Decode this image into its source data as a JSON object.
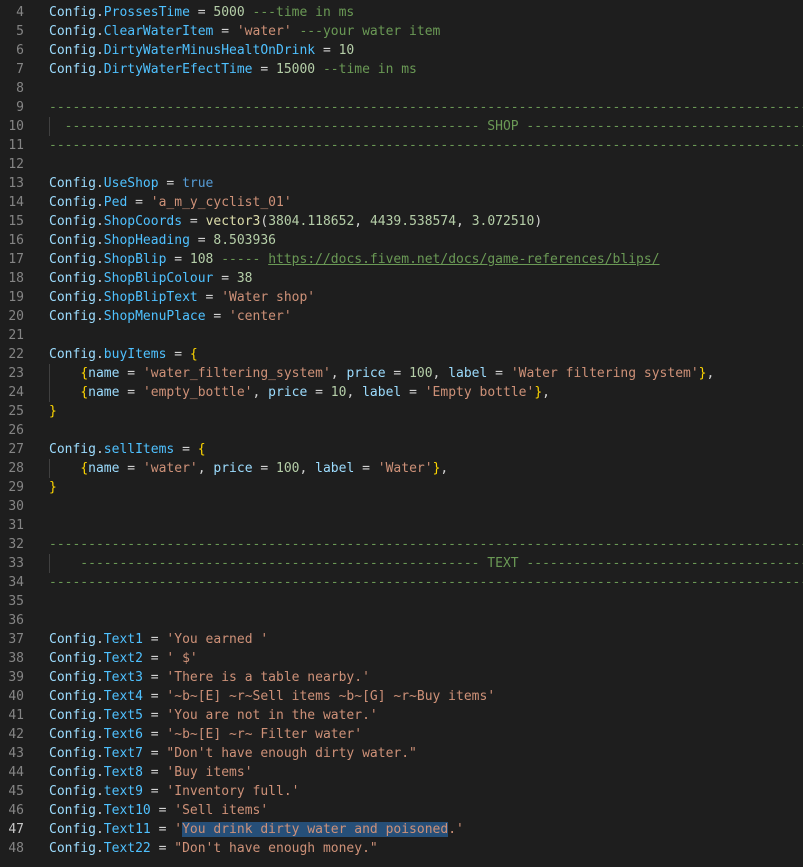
{
  "editor": {
    "active_line": 47,
    "lines": [
      {
        "n": 4,
        "tokens": [
          [
            "t-table",
            "Config"
          ],
          [
            "t-op",
            "."
          ],
          [
            "t-prop",
            "ProssesTime"
          ],
          [
            "t-op",
            " = "
          ],
          [
            "t-num",
            "5000"
          ],
          [
            "t-op",
            " "
          ],
          [
            "t-com",
            "---time in ms"
          ]
        ]
      },
      {
        "n": 5,
        "tokens": [
          [
            "t-table",
            "Config"
          ],
          [
            "t-op",
            "."
          ],
          [
            "t-prop",
            "ClearWaterItem"
          ],
          [
            "t-op",
            " = "
          ],
          [
            "t-str",
            "'water'"
          ],
          [
            "t-op",
            " "
          ],
          [
            "t-com",
            "---your water item"
          ]
        ]
      },
      {
        "n": 6,
        "tokens": [
          [
            "t-table",
            "Config"
          ],
          [
            "t-op",
            "."
          ],
          [
            "t-prop",
            "DirtyWaterMinusHealtOnDrink"
          ],
          [
            "t-op",
            " = "
          ],
          [
            "t-num",
            "10"
          ]
        ]
      },
      {
        "n": 7,
        "tokens": [
          [
            "t-table",
            "Config"
          ],
          [
            "t-op",
            "."
          ],
          [
            "t-prop",
            "DirtyWaterEfectTime"
          ],
          [
            "t-op",
            " = "
          ],
          [
            "t-num",
            "15000"
          ],
          [
            "t-op",
            " "
          ],
          [
            "t-com",
            "--time in ms"
          ]
        ]
      },
      {
        "n": 8,
        "tokens": []
      },
      {
        "n": 9,
        "tokens": [
          [
            "t-com",
            "--------------------------------------------------------------------------------------------------------------------------------"
          ]
        ]
      },
      {
        "n": 10,
        "tokens": [
          [
            "t-com",
            "  ----------------------------------------------------- SHOP ---------------------------------------------------------------------"
          ]
        ]
      },
      {
        "n": 11,
        "tokens": [
          [
            "t-com",
            "--------------------------------------------------------------------------------------------------------------------------------"
          ]
        ]
      },
      {
        "n": 12,
        "tokens": []
      },
      {
        "n": 13,
        "tokens": [
          [
            "t-table",
            "Config"
          ],
          [
            "t-op",
            "."
          ],
          [
            "t-prop",
            "UseShop"
          ],
          [
            "t-op",
            " = "
          ],
          [
            "t-kw",
            "true"
          ]
        ]
      },
      {
        "n": 14,
        "tokens": [
          [
            "t-table",
            "Config"
          ],
          [
            "t-op",
            "."
          ],
          [
            "t-prop",
            "Ped"
          ],
          [
            "t-op",
            " = "
          ],
          [
            "t-str",
            "'a_m_y_cyclist_01'"
          ]
        ]
      },
      {
        "n": 15,
        "tokens": [
          [
            "t-table",
            "Config"
          ],
          [
            "t-op",
            "."
          ],
          [
            "t-prop",
            "ShopCoords"
          ],
          [
            "t-op",
            " = "
          ],
          [
            "t-fn",
            "vector3"
          ],
          [
            "t-op",
            "("
          ],
          [
            "t-num",
            "3804.118652"
          ],
          [
            "t-op",
            ", "
          ],
          [
            "t-num",
            "4439.538574"
          ],
          [
            "t-op",
            ", "
          ],
          [
            "t-num",
            "3.072510"
          ],
          [
            "t-op",
            ")"
          ]
        ]
      },
      {
        "n": 16,
        "tokens": [
          [
            "t-table",
            "Config"
          ],
          [
            "t-op",
            "."
          ],
          [
            "t-prop",
            "ShopHeading"
          ],
          [
            "t-op",
            " = "
          ],
          [
            "t-num",
            "8.503936"
          ]
        ]
      },
      {
        "n": 17,
        "tokens": [
          [
            "t-table",
            "Config"
          ],
          [
            "t-op",
            "."
          ],
          [
            "t-prop",
            "ShopBlip"
          ],
          [
            "t-op",
            " = "
          ],
          [
            "t-num",
            "108"
          ],
          [
            "t-op",
            " "
          ],
          [
            "t-com",
            "----- "
          ],
          [
            "t-link",
            "https://docs.fivem.net/docs/game-references/blips/"
          ]
        ]
      },
      {
        "n": 18,
        "tokens": [
          [
            "t-table",
            "Config"
          ],
          [
            "t-op",
            "."
          ],
          [
            "t-prop",
            "ShopBlipColour"
          ],
          [
            "t-op",
            " = "
          ],
          [
            "t-num",
            "38"
          ]
        ]
      },
      {
        "n": 19,
        "tokens": [
          [
            "t-table",
            "Config"
          ],
          [
            "t-op",
            "."
          ],
          [
            "t-prop",
            "ShopBlipText"
          ],
          [
            "t-op",
            " = "
          ],
          [
            "t-str",
            "'Water shop'"
          ]
        ]
      },
      {
        "n": 20,
        "tokens": [
          [
            "t-table",
            "Config"
          ],
          [
            "t-op",
            "."
          ],
          [
            "t-prop",
            "ShopMenuPlace"
          ],
          [
            "t-op",
            " = "
          ],
          [
            "t-str",
            "'center'"
          ]
        ]
      },
      {
        "n": 21,
        "tokens": []
      },
      {
        "n": 22,
        "tokens": [
          [
            "t-table",
            "Config"
          ],
          [
            "t-op",
            "."
          ],
          [
            "t-prop",
            "buyItems"
          ],
          [
            "t-op",
            " = "
          ],
          [
            "t-brace",
            "{"
          ]
        ]
      },
      {
        "n": 23,
        "tokens": [
          [
            "t-op",
            "    "
          ],
          [
            "t-brace",
            "{"
          ],
          [
            "t-key",
            "name"
          ],
          [
            "t-op",
            " = "
          ],
          [
            "t-str",
            "'water_filtering_system'"
          ],
          [
            "t-op",
            ", "
          ],
          [
            "t-key",
            "price"
          ],
          [
            "t-op",
            " = "
          ],
          [
            "t-num",
            "100"
          ],
          [
            "t-op",
            ", "
          ],
          [
            "t-key",
            "label"
          ],
          [
            "t-op",
            " = "
          ],
          [
            "t-str",
            "'Water filtering system'"
          ],
          [
            "t-brace",
            "}"
          ],
          [
            "t-op",
            ","
          ]
        ]
      },
      {
        "n": 24,
        "tokens": [
          [
            "t-op",
            "    "
          ],
          [
            "t-brace",
            "{"
          ],
          [
            "t-key",
            "name"
          ],
          [
            "t-op",
            " = "
          ],
          [
            "t-str",
            "'empty_bottle'"
          ],
          [
            "t-op",
            ", "
          ],
          [
            "t-key",
            "price"
          ],
          [
            "t-op",
            " = "
          ],
          [
            "t-num",
            "10"
          ],
          [
            "t-op",
            ", "
          ],
          [
            "t-key",
            "label"
          ],
          [
            "t-op",
            " = "
          ],
          [
            "t-str",
            "'Empty bottle'"
          ],
          [
            "t-brace",
            "}"
          ],
          [
            "t-op",
            ","
          ]
        ]
      },
      {
        "n": 25,
        "tokens": [
          [
            "t-brace",
            "}"
          ]
        ]
      },
      {
        "n": 26,
        "tokens": []
      },
      {
        "n": 27,
        "tokens": [
          [
            "t-table",
            "Config"
          ],
          [
            "t-op",
            "."
          ],
          [
            "t-prop",
            "sellItems"
          ],
          [
            "t-op",
            " = "
          ],
          [
            "t-brace",
            "{"
          ]
        ]
      },
      {
        "n": 28,
        "tokens": [
          [
            "t-op",
            "    "
          ],
          [
            "t-brace",
            "{"
          ],
          [
            "t-key",
            "name"
          ],
          [
            "t-op",
            " = "
          ],
          [
            "t-str",
            "'water'"
          ],
          [
            "t-op",
            ", "
          ],
          [
            "t-key",
            "price"
          ],
          [
            "t-op",
            " = "
          ],
          [
            "t-num",
            "100"
          ],
          [
            "t-op",
            ", "
          ],
          [
            "t-key",
            "label"
          ],
          [
            "t-op",
            " = "
          ],
          [
            "t-str",
            "'Water'"
          ],
          [
            "t-brace",
            "}"
          ],
          [
            "t-op",
            ","
          ]
        ]
      },
      {
        "n": 29,
        "tokens": [
          [
            "t-brace",
            "}"
          ]
        ]
      },
      {
        "n": 30,
        "tokens": []
      },
      {
        "n": 31,
        "tokens": []
      },
      {
        "n": 32,
        "tokens": [
          [
            "t-com",
            "--------------------------------------------------------------------------------------------------------------------------------"
          ]
        ]
      },
      {
        "n": 33,
        "tokens": [
          [
            "t-com",
            "    --------------------------------------------------- TEXT -------------------------------------------------------------------"
          ]
        ]
      },
      {
        "n": 34,
        "tokens": [
          [
            "t-com",
            "--------------------------------------------------------------------------------------------------------------------------------"
          ]
        ]
      },
      {
        "n": 35,
        "tokens": []
      },
      {
        "n": 36,
        "tokens": []
      },
      {
        "n": 37,
        "tokens": [
          [
            "t-table",
            "Config"
          ],
          [
            "t-op",
            "."
          ],
          [
            "t-prop",
            "Text1"
          ],
          [
            "t-op",
            " = "
          ],
          [
            "t-str",
            "'You earned '"
          ]
        ]
      },
      {
        "n": 38,
        "tokens": [
          [
            "t-table",
            "Config"
          ],
          [
            "t-op",
            "."
          ],
          [
            "t-prop",
            "Text2"
          ],
          [
            "t-op",
            " = "
          ],
          [
            "t-str",
            "' $'"
          ]
        ]
      },
      {
        "n": 39,
        "tokens": [
          [
            "t-table",
            "Config"
          ],
          [
            "t-op",
            "."
          ],
          [
            "t-prop",
            "Text3"
          ],
          [
            "t-op",
            " = "
          ],
          [
            "t-str",
            "'There is a table nearby.'"
          ]
        ]
      },
      {
        "n": 40,
        "tokens": [
          [
            "t-table",
            "Config"
          ],
          [
            "t-op",
            "."
          ],
          [
            "t-prop",
            "Text4"
          ],
          [
            "t-op",
            " = "
          ],
          [
            "t-str",
            "'~b~[E] ~r~Sell items ~b~[G] ~r~Buy items'"
          ]
        ]
      },
      {
        "n": 41,
        "tokens": [
          [
            "t-table",
            "Config"
          ],
          [
            "t-op",
            "."
          ],
          [
            "t-prop",
            "Text5"
          ],
          [
            "t-op",
            " = "
          ],
          [
            "t-str",
            "'You are not in the water.'"
          ]
        ]
      },
      {
        "n": 42,
        "tokens": [
          [
            "t-table",
            "Config"
          ],
          [
            "t-op",
            "."
          ],
          [
            "t-prop",
            "Text6"
          ],
          [
            "t-op",
            " = "
          ],
          [
            "t-str",
            "'~b~[E] ~r~ Filter water'"
          ]
        ]
      },
      {
        "n": 43,
        "tokens": [
          [
            "t-table",
            "Config"
          ],
          [
            "t-op",
            "."
          ],
          [
            "t-prop",
            "Text7"
          ],
          [
            "t-op",
            " = "
          ],
          [
            "t-str",
            "\"Don't have enough dirty water.\""
          ]
        ]
      },
      {
        "n": 44,
        "tokens": [
          [
            "t-table",
            "Config"
          ],
          [
            "t-op",
            "."
          ],
          [
            "t-prop",
            "Text8"
          ],
          [
            "t-op",
            " = "
          ],
          [
            "t-str",
            "'Buy items'"
          ]
        ]
      },
      {
        "n": 45,
        "tokens": [
          [
            "t-table",
            "Config"
          ],
          [
            "t-op",
            "."
          ],
          [
            "t-prop",
            "text9"
          ],
          [
            "t-op",
            " = "
          ],
          [
            "t-str",
            "'Inventory full.'"
          ]
        ]
      },
      {
        "n": 46,
        "tokens": [
          [
            "t-table",
            "Config"
          ],
          [
            "t-op",
            "."
          ],
          [
            "t-prop",
            "Text10"
          ],
          [
            "t-op",
            " = "
          ],
          [
            "t-str",
            "'Sell items'"
          ]
        ]
      },
      {
        "n": 47,
        "tokens": [
          [
            "t-table",
            "Config"
          ],
          [
            "t-op",
            "."
          ],
          [
            "t-prop",
            "Text11"
          ],
          [
            "t-op",
            " = "
          ],
          [
            "t-str",
            "'"
          ],
          [
            "t-sel",
            "You drink dirty water and poisoned"
          ],
          [
            "t-str",
            ".'"
          ]
        ]
      },
      {
        "n": 48,
        "tokens": [
          [
            "t-table",
            "Config"
          ],
          [
            "t-op",
            "."
          ],
          [
            "t-prop",
            "Text22"
          ],
          [
            "t-op",
            " = "
          ],
          [
            "t-str",
            "\"Don't have enough money.\""
          ]
        ]
      }
    ]
  }
}
